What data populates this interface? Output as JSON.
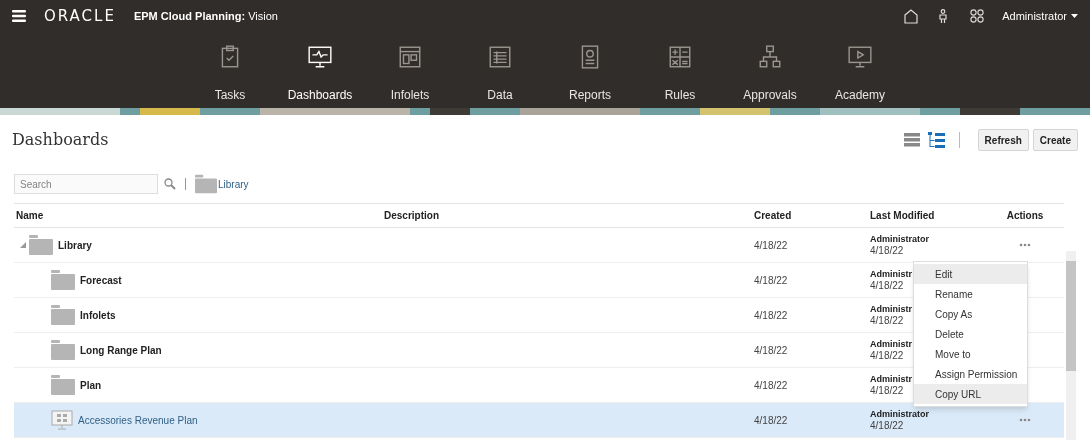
{
  "topbar": {
    "brand": "ORACLE",
    "app_name": "EPM Cloud Planning:",
    "app_suffix": "Vision",
    "user": "Administrator"
  },
  "nav": [
    {
      "label": "Tasks",
      "kind": "tasks",
      "selected": false
    },
    {
      "label": "Dashboards",
      "kind": "dashboards",
      "selected": true
    },
    {
      "label": "Infolets",
      "kind": "infolets",
      "selected": false
    },
    {
      "label": "Data",
      "kind": "data",
      "selected": false
    },
    {
      "label": "Reports",
      "kind": "reports",
      "selected": false
    },
    {
      "label": "Rules",
      "kind": "rules",
      "selected": false
    },
    {
      "label": "Approvals",
      "kind": "approvals",
      "selected": false
    },
    {
      "label": "Academy",
      "kind": "academy",
      "selected": false
    }
  ],
  "page": {
    "title": "Dashboards",
    "views": [
      {
        "kind": "list",
        "selected": false
      },
      {
        "kind": "tree",
        "selected": true
      }
    ],
    "buttons": [
      "Refresh",
      "Create"
    ]
  },
  "search": {
    "placeholder": "Search"
  },
  "breadcrumb": "Library",
  "table": {
    "columns": [
      "Name",
      "Description",
      "Created",
      "Last Modified",
      "Actions"
    ],
    "rows": [
      {
        "kind": "folder",
        "name": "Library",
        "expanded": true,
        "created": "4/18/22",
        "modified_by": "Administrator",
        "modified": "4/18/22",
        "actions": true,
        "selected": false,
        "children": [
          {
            "kind": "folder",
            "name": "Forecast",
            "created": "4/18/22",
            "modified_by": "Administr",
            "modified": "4/18/22",
            "actions": false,
            "selected": false
          },
          {
            "kind": "folder",
            "name": "Infolets",
            "created": "4/18/22",
            "modified_by": "Administr",
            "modified": "4/18/22",
            "actions": false,
            "selected": false
          },
          {
            "kind": "folder",
            "name": "Long Range Plan",
            "created": "4/18/22",
            "modified_by": "Administr",
            "modified": "4/18/22",
            "actions": false,
            "selected": false
          },
          {
            "kind": "folder",
            "name": "Plan",
            "created": "4/18/22",
            "modified_by": "Administr",
            "modified": "4/18/22",
            "actions": false,
            "selected": false
          },
          {
            "kind": "dashboard",
            "name": "Accessories Revenue Plan",
            "created": "4/18/22",
            "modified_by": "Administrator",
            "modified": "4/18/22",
            "actions": true,
            "selected": true
          }
        ]
      }
    ]
  },
  "menu": [
    {
      "label": "Edit",
      "highlighted": true
    },
    {
      "label": "Rename",
      "highlighted": false
    },
    {
      "label": "Copy As",
      "highlighted": false
    },
    {
      "label": "Delete",
      "highlighted": false
    },
    {
      "label": "Move to",
      "highlighted": false
    },
    {
      "label": "Assign Permission",
      "highlighted": false
    },
    {
      "label": "Copy URL",
      "highlighted": true
    }
  ]
}
